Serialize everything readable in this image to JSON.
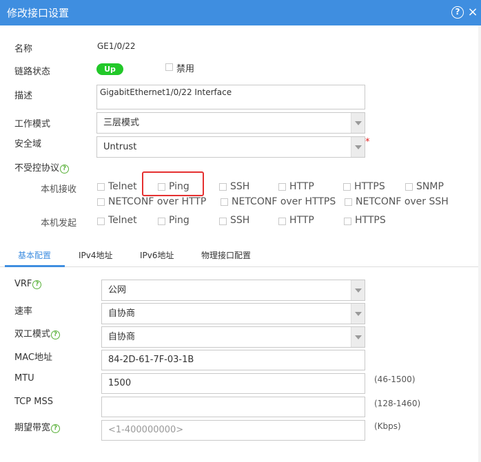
{
  "dialog": {
    "title": "修改接口设置",
    "help_icon": "?",
    "close_icon": "×"
  },
  "form": {
    "name_label": "名称",
    "name_value": "GE1/0/22",
    "link_label": "链路状态",
    "link_status": "Up",
    "disable_label": "禁用",
    "desc_label": "描述",
    "desc_value": "GigabitEthernet1/0/22 Interface",
    "mode_label": "工作模式",
    "mode_value": "三层模式",
    "zone_label": "安全域",
    "zone_value": "Untrust",
    "required_mark": "*",
    "uncontrolled_label": "不受控协议",
    "help_glyph": "?"
  },
  "protocols": {
    "receive_label": "本机接收",
    "send_label": "本机发起",
    "receive": [
      "Telnet",
      "Ping",
      "SSH",
      "HTTP",
      "HTTPS",
      "SNMP",
      "NETCONF over HTTP",
      "NETCONF over HTTPS",
      "NETCONF over SSH"
    ],
    "send": [
      "Telnet",
      "Ping",
      "SSH",
      "HTTP",
      "HTTPS"
    ]
  },
  "tabs": [
    "基本配置",
    "IPv4地址",
    "IPv6地址",
    "物理接口配置"
  ],
  "basic": {
    "vrf_label": "VRF",
    "vrf_value": "公网",
    "speed_label": "速率",
    "speed_value": "自协商",
    "duplex_label": "双工模式",
    "duplex_value": "自协商",
    "mac_label": "MAC地址",
    "mac_value": "84-2D-61-7F-03-1B",
    "mtu_label": "MTU",
    "mtu_value": "1500",
    "mtu_hint": "(46-1500)",
    "tcpmss_label": "TCP MSS",
    "tcpmss_value": "",
    "tcpmss_hint": "(128-1460)",
    "bw_label": "期望带宽",
    "bw_placeholder": "<1-400000000>",
    "bw_hint": "(Kbps)"
  },
  "colors": {
    "title_bar": "#3f8ee0",
    "status_up": "#22c829",
    "highlight": "#e53030",
    "help_green": "#58b038"
  }
}
